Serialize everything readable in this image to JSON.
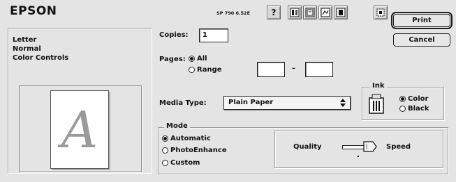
{
  "header": {
    "brand": "EPSON",
    "version": "SP 790 6.52E"
  },
  "toolbar": {
    "icons": [
      "help-icon",
      "page-layout-icon",
      "print-preview-icon",
      "background-printing-icon",
      "utility-icon",
      "custom-settings-icon"
    ]
  },
  "buttons": {
    "print": "Print",
    "cancel": "Cancel"
  },
  "summary": {
    "lines": [
      "Letter",
      "Normal",
      "Color Controls"
    ]
  },
  "preview": {
    "glyph": "A"
  },
  "copies": {
    "label": "Copies:",
    "value": "1"
  },
  "pages": {
    "label": "Pages:",
    "all_label": "All",
    "range_label": "Range",
    "selected": "All",
    "range_from": "",
    "range_to": "",
    "dash": "–"
  },
  "media_type": {
    "label": "Media Type:",
    "value": "Plain Paper"
  },
  "ink": {
    "title": "Ink",
    "options": [
      "Color",
      "Black"
    ],
    "selected": "Color"
  },
  "mode": {
    "title": "Mode",
    "options": [
      "Automatic",
      "PhotoEnhance",
      "Custom"
    ],
    "selected": "Automatic",
    "quality_label": "Quality",
    "speed_label": "Speed",
    "slider_position": 0.75
  },
  "colors": {
    "background": "#e4e4e4",
    "text": "#111111"
  }
}
